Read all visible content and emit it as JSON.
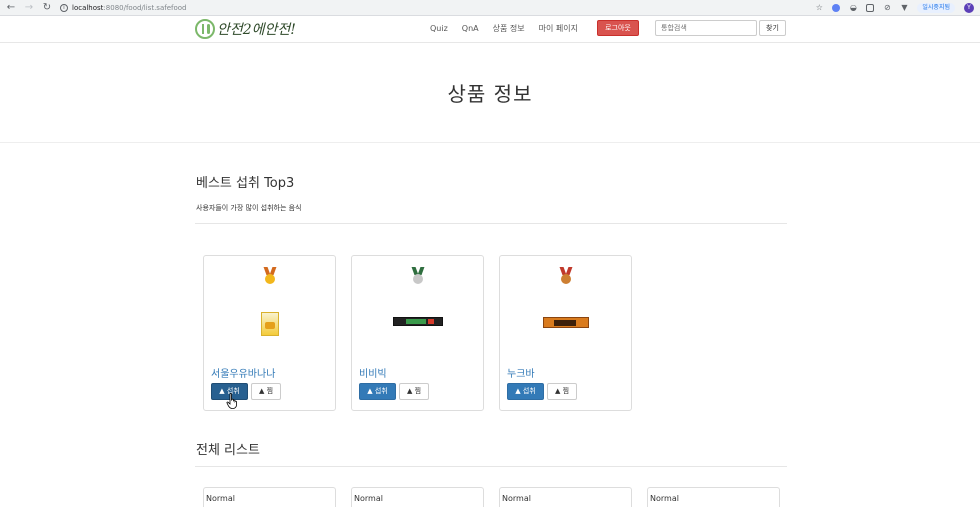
{
  "browser": {
    "url_host": "localhost",
    "url_path": ":8080/food/list.safefood",
    "pause_label": "일시중지됨",
    "profile_initial": "Y"
  },
  "navbar": {
    "brand": "안전2에안전!",
    "links": [
      "Quiz",
      "QnA",
      "상품 정보",
      "마이 페이지"
    ],
    "logout_label": "로그아웃",
    "search_placeholder": "통합검색",
    "search_button_label": "찾기"
  },
  "header": {
    "title": "상품 정보"
  },
  "best": {
    "title": "베스트 섭취 Top3",
    "description": "사용자들이 가장 많이 섭취하는 음식",
    "items": [
      {
        "rank_medal": "gold-medal-icon",
        "name": "서울우유바나나",
        "intake_label": "▲ 섭취",
        "pick_label": "▲ 찜"
      },
      {
        "rank_medal": "silver-medal-icon",
        "name": "비비빅",
        "intake_label": "▲ 섭취",
        "pick_label": "▲ 찜"
      },
      {
        "rank_medal": "bronze-medal-icon",
        "name": "누크바",
        "intake_label": "▲ 섭취",
        "pick_label": "▲ 찜"
      }
    ]
  },
  "all_list": {
    "title": "전체 리스트",
    "items": [
      {
        "label": "Normal"
      },
      {
        "label": "Normal"
      },
      {
        "label": "Normal"
      },
      {
        "label": "Normal"
      }
    ]
  },
  "colors": {
    "primary": "#337ab7",
    "danger": "#d9534f"
  }
}
